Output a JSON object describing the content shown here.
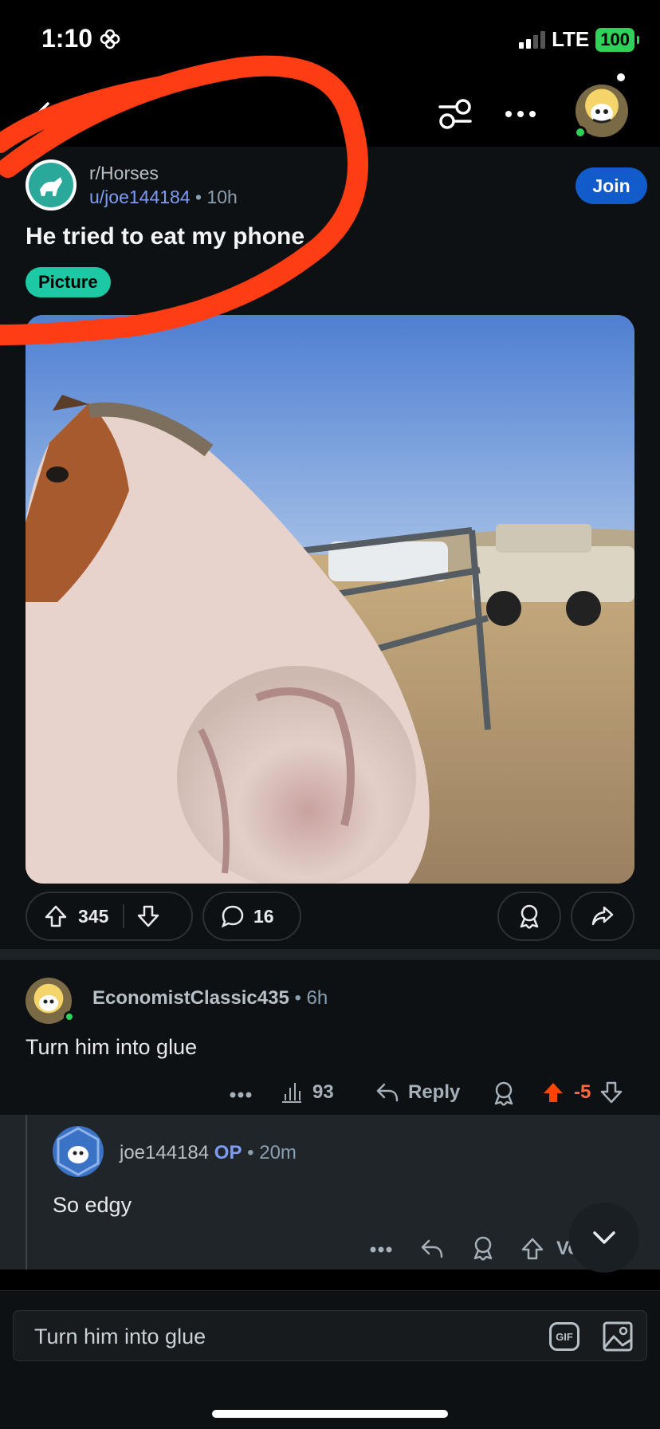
{
  "status_bar": {
    "time": "1:10",
    "network": "LTE",
    "battery": "100"
  },
  "nav": {
    "back_icon": "arrow-left-icon",
    "filter_icon": "sliders-icon",
    "more_icon": "more-horizontal-icon"
  },
  "post": {
    "subreddit": "r/Horses",
    "author": "u/joe144184",
    "age": "10h",
    "join_label": "Join",
    "title": "He tried to eat my phone",
    "flair": "Picture",
    "upvotes": "345",
    "comments": "16"
  },
  "comment": {
    "user": "EconomistClassic435",
    "age": "6h",
    "body": "Turn him into glue",
    "views": "93",
    "reply_label": "Reply",
    "score": "-5"
  },
  "reply": {
    "user": "joe144184",
    "op_label": "OP",
    "age": "20m",
    "body": "So edgy",
    "vote_partial": "Vo"
  },
  "composer": {
    "text": "Turn him into glue",
    "gif_label": "GIF"
  },
  "colors": {
    "accent_blue": "#115bca",
    "flair_teal": "#1dc9a4",
    "upvote_orange": "#ff4500",
    "annotation_red": "#ff3d14"
  }
}
